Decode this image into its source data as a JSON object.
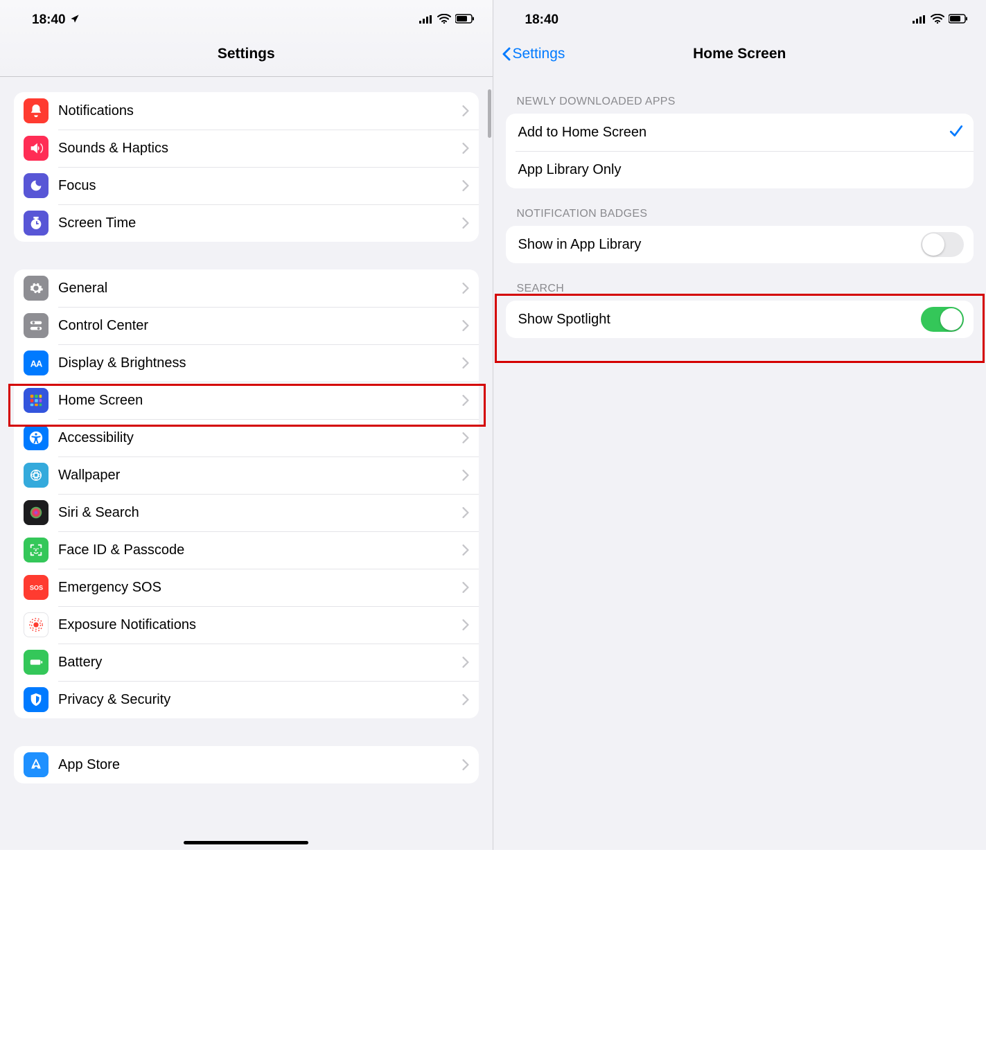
{
  "status": {
    "time": "18:40"
  },
  "left": {
    "title": "Settings",
    "group1": [
      {
        "label": "Notifications",
        "iconColor": "#ff3b30",
        "name": "notifications"
      },
      {
        "label": "Sounds & Haptics",
        "iconColor": "#ff2d55",
        "name": "sounds"
      },
      {
        "label": "Focus",
        "iconColor": "#5856d6",
        "name": "focus"
      },
      {
        "label": "Screen Time",
        "iconColor": "#5856d6",
        "name": "screen-time"
      }
    ],
    "group2": [
      {
        "label": "General",
        "iconColor": "#8e8e93",
        "name": "general"
      },
      {
        "label": "Control Center",
        "iconColor": "#8e8e93",
        "name": "control-center"
      },
      {
        "label": "Display & Brightness",
        "iconColor": "#007aff",
        "name": "display"
      },
      {
        "label": "Home Screen",
        "iconColor": "#3355dd",
        "name": "home-screen"
      },
      {
        "label": "Accessibility",
        "iconColor": "#007aff",
        "name": "accessibility"
      },
      {
        "label": "Wallpaper",
        "iconColor": "#34aadc",
        "name": "wallpaper"
      },
      {
        "label": "Siri & Search",
        "iconColor": "#1c1c1e",
        "name": "siri"
      },
      {
        "label": "Face ID & Passcode",
        "iconColor": "#34c759",
        "name": "faceid"
      },
      {
        "label": "Emergency SOS",
        "iconColor": "#ff3b30",
        "name": "sos"
      },
      {
        "label": "Exposure Notifications",
        "iconColor": "#ffffff",
        "name": "exposure"
      },
      {
        "label": "Battery",
        "iconColor": "#34c759",
        "name": "battery"
      },
      {
        "label": "Privacy & Security",
        "iconColor": "#007aff",
        "name": "privacy"
      }
    ],
    "group3": [
      {
        "label": "App Store",
        "iconColor": "#1e90ff",
        "name": "app-store"
      }
    ]
  },
  "right": {
    "back": "Settings",
    "title": "Home Screen",
    "section1": {
      "header": "Newly Downloaded Apps",
      "opt1": "Add to Home Screen",
      "opt2": "App Library Only"
    },
    "section2": {
      "header": "Notification Badges",
      "opt1": "Show in App Library"
    },
    "section3": {
      "header": "Search",
      "opt1": "Show Spotlight"
    }
  }
}
